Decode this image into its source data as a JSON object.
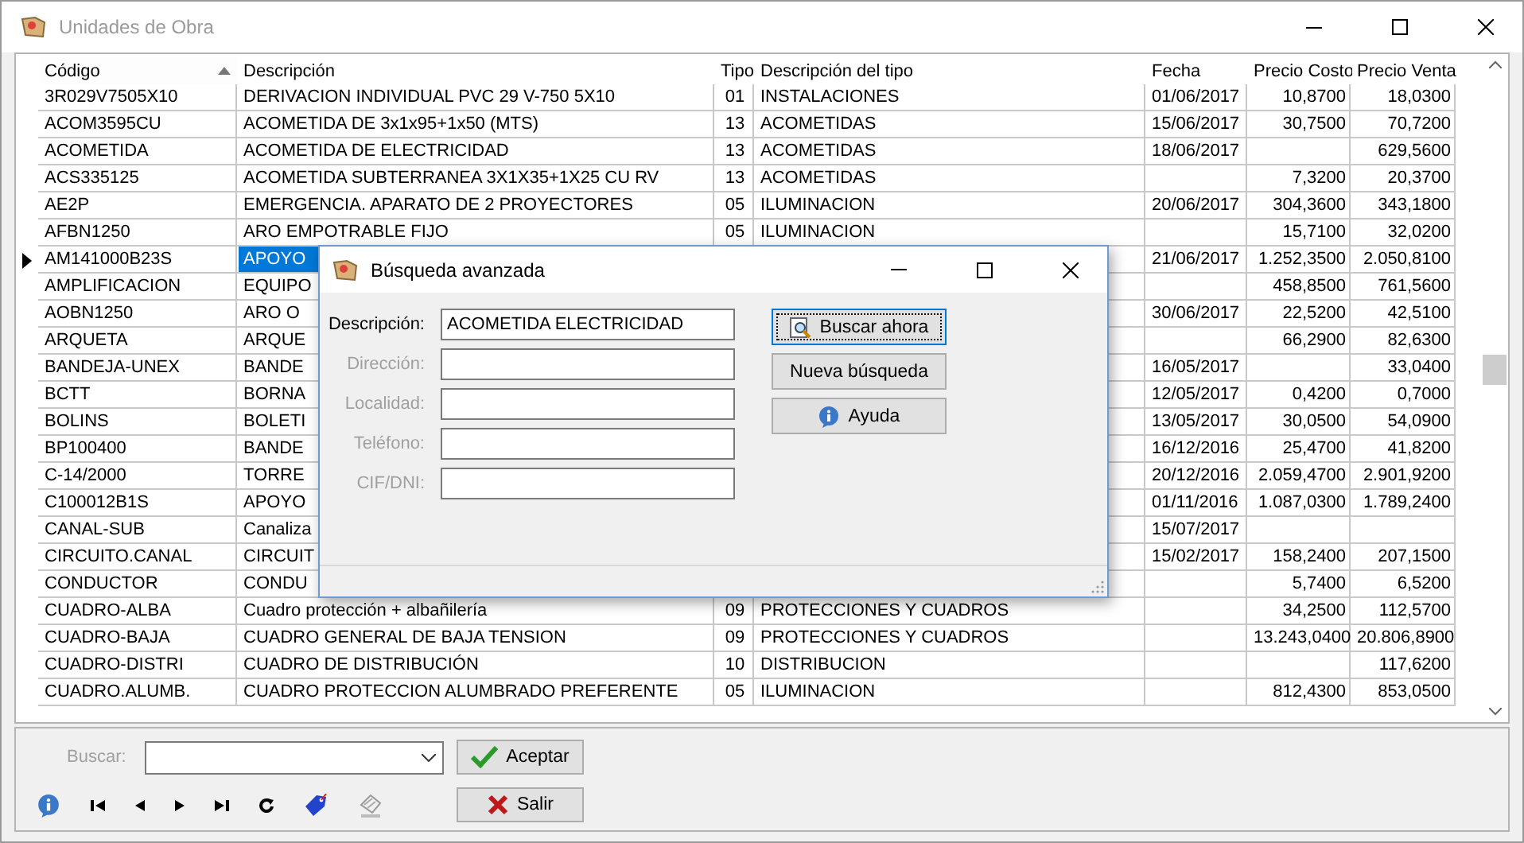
{
  "window": {
    "title": "Unidades de Obra"
  },
  "table": {
    "columns": [
      {
        "label": "Código",
        "sorted": true
      },
      {
        "label": "Descripción",
        "sorted": false
      },
      {
        "label": "Tipo",
        "sorted": false
      },
      {
        "label": "Descripción del tipo",
        "sorted": false
      },
      {
        "label": "Fecha",
        "sorted": false
      },
      {
        "label": "Precio Costo",
        "sorted": false
      },
      {
        "label": "Precio Venta",
        "sorted": false
      }
    ],
    "rows": [
      {
        "selected": false,
        "codigo": "3R029V7505X10",
        "descripcion": "DERIVACION INDIVIDUAL PVC 29 V-750 5X10",
        "tipo": "01",
        "tipo_desc": "INSTALACIONES",
        "fecha": "01/06/2017",
        "costo": "10,8700",
        "venta": "18,0300"
      },
      {
        "selected": false,
        "codigo": "ACOM3595CU",
        "descripcion": "ACOMETIDA DE 3x1x95+1x50 (MTS)",
        "tipo": "13",
        "tipo_desc": "ACOMETIDAS",
        "fecha": "15/06/2017",
        "costo": "30,7500",
        "venta": "70,7200"
      },
      {
        "selected": false,
        "codigo": "ACOMETIDA",
        "descripcion": "ACOMETIDA DE ELECTRICIDAD",
        "tipo": "13",
        "tipo_desc": "ACOMETIDAS",
        "fecha": "18/06/2017",
        "venta": "629,5600"
      },
      {
        "selected": false,
        "codigo": "ACS335125",
        "descripcion": "ACOMETIDA SUBTERRANEA 3X1X35+1X25 CU RV",
        "tipo": "13",
        "tipo_desc": "ACOMETIDAS",
        "costo": "7,3200",
        "venta": "20,3700"
      },
      {
        "selected": false,
        "codigo": "AE2P",
        "descripcion": "EMERGENCIA. APARATO DE 2 PROYECTORES",
        "tipo": "05",
        "tipo_desc": "ILUMINACION",
        "fecha": "20/06/2017",
        "costo": "304,3600",
        "venta": "343,1800"
      },
      {
        "selected": false,
        "codigo": "AFBN1250",
        "descripcion": "ARO EMPOTRABLE FIJO",
        "tipo": "05",
        "tipo_desc": "ILUMINACION",
        "costo": "15,7100",
        "venta": "32,0200"
      },
      {
        "selected": true,
        "codigo": "AM141000B23S",
        "descripcion": "APOYO",
        "fecha": "21/06/2017",
        "costo": "1.252,3500",
        "venta": "2.050,8100"
      },
      {
        "selected": false,
        "codigo": "AMPLIFICACION",
        "descripcion": "EQUIPO",
        "costo": "458,8500",
        "venta": "761,5600"
      },
      {
        "selected": false,
        "codigo": "AOBN1250",
        "descripcion": "ARO O",
        "fecha": "30/06/2017",
        "costo": "22,5200",
        "venta": "42,5100"
      },
      {
        "selected": false,
        "codigo": "ARQUETA",
        "descripcion": "ARQUE",
        "costo": "66,2900",
        "venta": "82,6300"
      },
      {
        "selected": false,
        "codigo": "BANDEJA-UNEX",
        "descripcion": "BANDE",
        "fecha": "16/05/2017",
        "venta": "33,0400"
      },
      {
        "selected": false,
        "codigo": "BCTT",
        "descripcion": "BORNA",
        "fecha": "12/05/2017",
        "costo": "0,4200",
        "venta": "0,7000"
      },
      {
        "selected": false,
        "codigo": "BOLINS",
        "descripcion": "BOLETI",
        "fecha": "13/05/2017",
        "costo": "30,0500",
        "venta": "54,0900"
      },
      {
        "selected": false,
        "codigo": "BP100400",
        "descripcion": "BANDE",
        "fecha": "16/12/2016",
        "costo": "25,4700",
        "venta": "41,8200"
      },
      {
        "selected": false,
        "codigo": "C-14/2000",
        "descripcion": "TORRE",
        "fecha": "20/12/2016",
        "costo": "2.059,4700",
        "venta": "2.901,9200"
      },
      {
        "selected": false,
        "codigo": "C100012B1S",
        "descripcion": "APOYO",
        "fecha": "01/11/2016",
        "costo": "1.087,0300",
        "venta": "1.789,2400"
      },
      {
        "selected": false,
        "codigo": "CANAL-SUB",
        "descripcion": "Canaliza",
        "fecha": "15/07/2017"
      },
      {
        "selected": false,
        "codigo": "CIRCUITO.CANAL",
        "descripcion": "CIRCUIT",
        "fecha": "15/02/2017",
        "costo": "158,2400",
        "venta": "207,1500"
      },
      {
        "selected": false,
        "codigo": "CONDUCTOR",
        "descripcion": "CONDU",
        "costo": "5,7400",
        "venta": "6,5200"
      },
      {
        "selected": false,
        "codigo": "CUADRO-ALBA",
        "descripcion": "Cuadro protección + albañilería",
        "tipo": "09",
        "tipo_desc": "PROTECCIONES Y CUADROS",
        "costo": "34,2500",
        "venta": "112,5700"
      },
      {
        "selected": false,
        "codigo": "CUADRO-BAJA",
        "descripcion": "CUADRO GENERAL DE BAJA TENSION",
        "tipo": "09",
        "tipo_desc": "PROTECCIONES Y CUADROS",
        "costo": "13.243,0400",
        "venta": "20.806,8900"
      },
      {
        "selected": false,
        "codigo": "CUADRO-DISTRI",
        "descripcion": "CUADRO DE DISTRIBUCIÓN",
        "tipo": "10",
        "tipo_desc": "DISTRIBUCION",
        "venta": "117,6200"
      },
      {
        "selected": false,
        "codigo": "CUADRO.ALUMB.",
        "descripcion": "CUADRO PROTECCION ALUMBRADO PREFERENTE",
        "tipo": "05",
        "tipo_desc": "ILUMINACION",
        "costo": "812,4300",
        "venta": "853,0500"
      }
    ]
  },
  "bottom": {
    "search_label": "Buscar:",
    "search_disabled": true,
    "buttons": [
      {
        "label": "Aceptar",
        "kind": "accept"
      },
      {
        "label": "Salir",
        "kind": "exit"
      }
    ]
  },
  "dialog": {
    "title": "Búsqueda avanzada",
    "fields": [
      {
        "label": "Descripción:",
        "value": "ACOMETIDA ELECTRICIDAD",
        "disabled": false
      },
      {
        "label": "Dirección:",
        "disabled": true
      },
      {
        "label": "Localidad:",
        "disabled": true
      },
      {
        "label": "Teléfono:",
        "disabled": true
      },
      {
        "label": "CIF/DNI:",
        "disabled": true
      }
    ],
    "buttons": [
      {
        "label": "Buscar ahora",
        "kind": "search",
        "focused": true
      },
      {
        "label": "Nueva búsqueda",
        "kind": "plain",
        "focused": false
      },
      {
        "label": "Ayuda",
        "kind": "help",
        "focused": false
      }
    ]
  }
}
